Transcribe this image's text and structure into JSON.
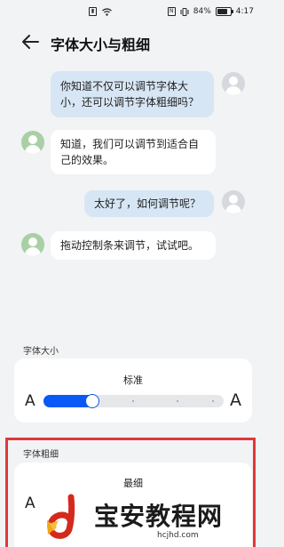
{
  "status": {
    "battery": "84%",
    "time": "4:17",
    "icons": [
      "sim-icon",
      "wifi-icon",
      "nfc-icon",
      "vibrate-icon",
      "battery-icon"
    ]
  },
  "header": {
    "title": "字体大小与粗细"
  },
  "chat": [
    {
      "side": "right",
      "text_lines": [
        "你知道不仅可以调节字体大",
        "小，还可以调节字体粗细吗？"
      ]
    },
    {
      "side": "left",
      "text_lines": [
        "知道，我们可以调节到适合自",
        "己的效果。"
      ]
    },
    {
      "side": "right",
      "text_lines": [
        "太好了，如何调节呢？"
      ]
    },
    {
      "side": "left",
      "text_lines": [
        "拖动控制条来调节，试试吧。"
      ]
    }
  ],
  "font_size": {
    "label": "字体大小",
    "value_label": "标准",
    "small_letter": "A",
    "large_letter": "A",
    "level": 0.25
  },
  "font_weight": {
    "label": "字体粗细",
    "value_label": "最细",
    "small_letter": "A"
  },
  "watermark": {
    "text": "宝安教程网",
    "url": "hcjhd.com"
  },
  "colors": {
    "accent": "#0a59f7",
    "highlight": "#e0383a",
    "right_bubble": "#d7e6f4"
  }
}
